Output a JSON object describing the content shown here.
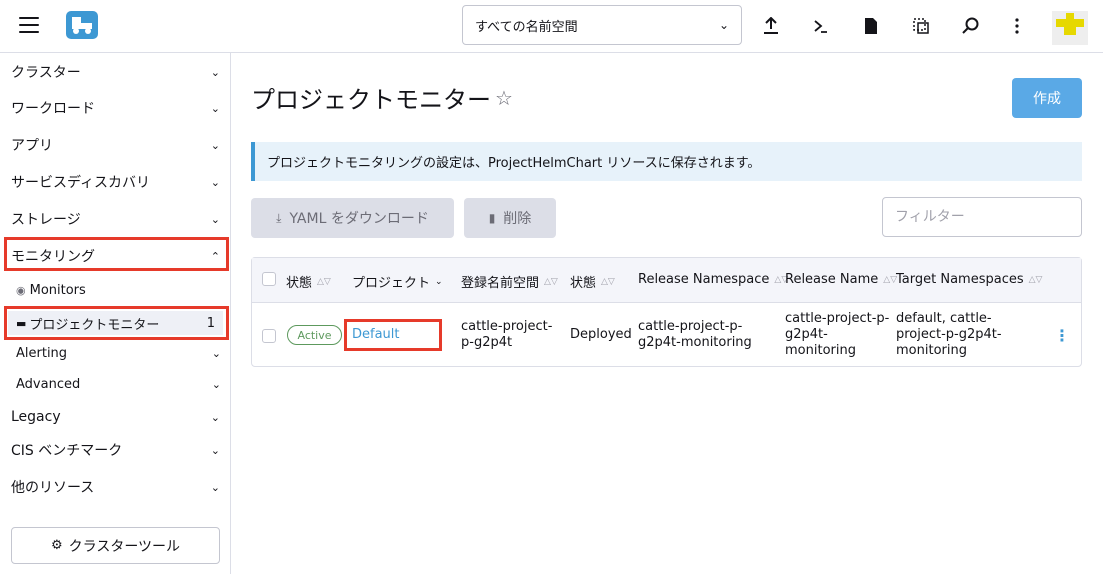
{
  "header": {
    "namespace_selected": "すべての名前空間"
  },
  "sidebar": {
    "items": [
      {
        "label": "クラスター"
      },
      {
        "label": "ワークロード"
      },
      {
        "label": "アプリ"
      },
      {
        "label": "サービスディスカバリ"
      },
      {
        "label": "ストレージ"
      },
      {
        "label": "モニタリング"
      }
    ],
    "monitoring_sub": [
      {
        "label": "Monitors"
      },
      {
        "label": "プロジェクトモニター",
        "count": "1"
      },
      {
        "label": "Alerting"
      },
      {
        "label": "Advanced"
      }
    ],
    "items_after": [
      {
        "label": "Legacy"
      },
      {
        "label": "CIS ベンチマーク"
      },
      {
        "label": "他のリソース"
      }
    ],
    "tools_button": "クラスターツール"
  },
  "page": {
    "title": "プロジェクトモニター",
    "create_button": "作成",
    "banner": "プロジェクトモニタリングの設定は、ProjectHelmChart リソースに保存されます。",
    "download_button": "YAML をダウンロード",
    "delete_button": "削除",
    "filter_placeholder": "フィルター"
  },
  "table": {
    "columns": [
      "状態",
      "プロジェクト",
      "登録名前空間",
      "状態",
      "Release Namespace",
      "Release Name",
      "Target Namespaces"
    ],
    "rows": [
      {
        "status": "Active",
        "project": "Default",
        "registered_namespace_l1": "cattle-project-",
        "registered_namespace_l2": "p-g2p4t",
        "state": "Deployed",
        "release_namespace_l1": "cattle-project-p-",
        "release_namespace_l2": "g2p4t-monitoring",
        "release_name_l1": "cattle-project-p-",
        "release_name_l2": "g2p4t-",
        "release_name_l3": "monitoring",
        "target_namespaces_l1": "default, cattle-",
        "target_namespaces_l2": "project-p-g2p4t-",
        "target_namespaces_l3": "monitoring"
      }
    ]
  },
  "colors": {
    "accent": "#3d98d3",
    "highlight": "#e63a2a",
    "active_badge": "#5d995d"
  }
}
